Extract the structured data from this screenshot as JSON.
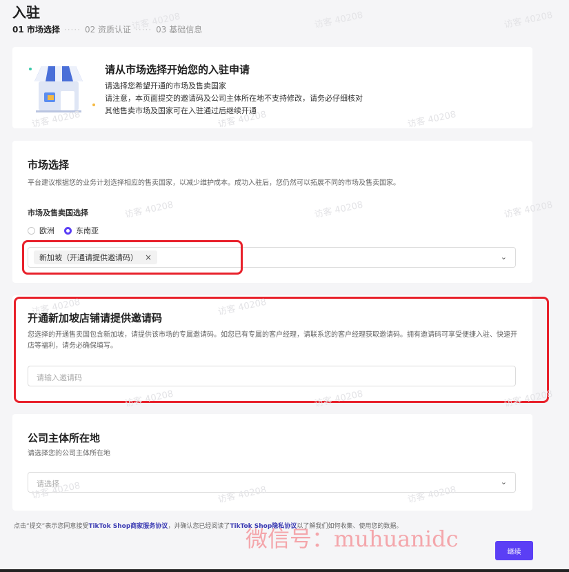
{
  "header": {
    "title": "入驻",
    "steps": [
      {
        "label": "01 市场选择",
        "active": true
      },
      {
        "label": "02 资质认证",
        "active": false
      },
      {
        "label": "03 基础信息",
        "active": false
      }
    ],
    "step_separator": "·····"
  },
  "intro": {
    "title": "请从市场选择开始您的入驻申请",
    "lines": [
      "请选择您希望开通的市场及售卖国家",
      "请注意，本页面提交的邀请码及公司主体所在地不支持修改，请务必仔细核对",
      "其他售卖市场及国家可在入驻通过后继续开通"
    ]
  },
  "market": {
    "title": "市场选择",
    "description": "平台建议根据您的业务计划选择相应的售卖国家，以减少维护成本。成功入驻后，您仍然可以拓展不同的市场及售卖国家。",
    "field_label": "市场及售卖国选择",
    "options": [
      {
        "label": "欧洲",
        "selected": false
      },
      {
        "label": "东南亚",
        "selected": true
      }
    ],
    "selected_tag": "新加坡（开通请提供邀请码）",
    "tag_close": "×"
  },
  "invite": {
    "title": "开通新加坡店铺请提供邀请码",
    "description": "您选择的开通售卖国包含新加坡，请提供该市场的专属邀请码。如您已有专属的客户经理，请联系您的客户经理获取邀请码。拥有邀请码可享受便捷入驻、快速开店等福利，请务必确保填写。",
    "placeholder": "请输入邀请码"
  },
  "company": {
    "title": "公司主体所在地",
    "description": "请选择您的公司主体所在地",
    "placeholder": "请选择"
  },
  "footer": {
    "prefix": "点击“提交”表示您同意接受",
    "link1": "TikTok Shop商家服务协议",
    "middle": "，并确认您已经阅读了",
    "link2": "TikTok Shop隐私协议",
    "suffix": "以了解我们如何收集、使用您的数据。"
  },
  "continue_label": "继续",
  "chevron": "⌄",
  "watermark": {
    "id_text": "访客 40208",
    "wechat": "微信号：muhuanidc"
  },
  "colors": {
    "accent": "#5b3ff5",
    "highlight_red": "#e8212b",
    "background": "#f5f5f7"
  }
}
